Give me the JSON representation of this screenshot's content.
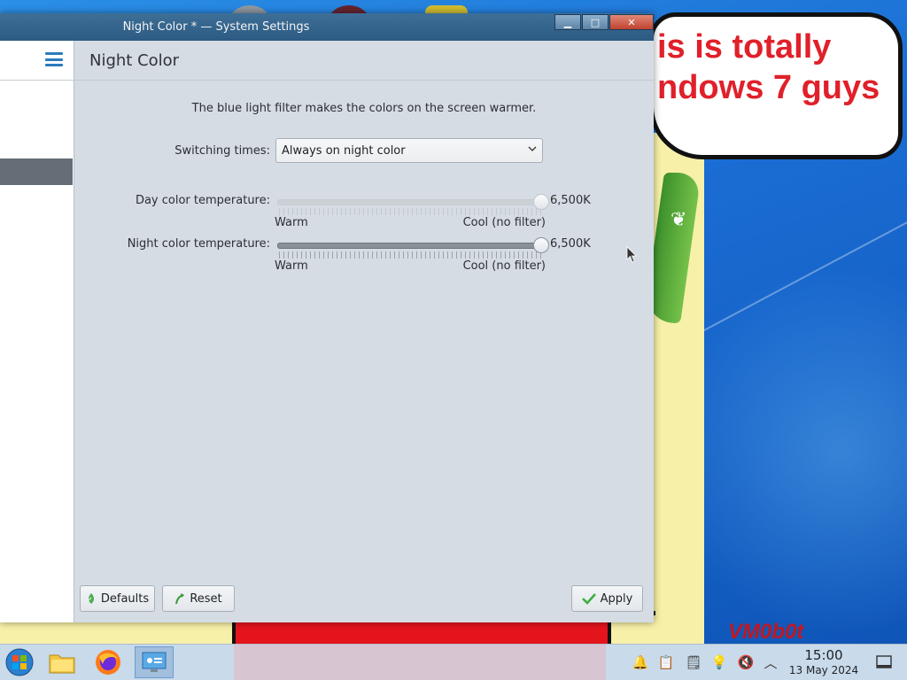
{
  "window": {
    "title": "Night Color * — System Settings",
    "minimize_glyph": "▁",
    "maximize_glyph": "□",
    "close_glyph": "✕"
  },
  "page": {
    "title": "Night Color",
    "description": "The blue light filter makes the colors on the screen warmer."
  },
  "switching": {
    "label": "Switching times:",
    "selected": "Always on night color"
  },
  "day_temp": {
    "label": "Day color temperature:",
    "value_text": "6,500K",
    "warm_label": "Warm",
    "cool_label": "Cool (no filter)",
    "level": 1.0,
    "enabled": false
  },
  "night_temp": {
    "label": "Night color temperature:",
    "value_text": "6,500K",
    "warm_label": "Warm",
    "cool_label": "Cool (no filter)",
    "level": 1.0,
    "enabled": true
  },
  "footer": {
    "defaults_label": "Defaults",
    "reset_label": "Reset",
    "apply_label": "Apply"
  },
  "desktop": {
    "bubble_line1": "is is totally",
    "bubble_line2": "ndows 7 guys",
    "watermark": "VM0b0t"
  },
  "taskbar": {
    "apps": [
      "start-menu-icon",
      "file-manager-icon",
      "firefox-icon",
      "system-settings-icon"
    ],
    "tray": [
      "notifications-icon",
      "clipboard-icon",
      "tasks-icon",
      "night-color-icon",
      "volume-muted-icon",
      "expand-tray-icon"
    ],
    "time": "15:00",
    "date": "13 May 2024"
  },
  "colors": {
    "accent": "#2a7bbf",
    "window_bg": "#d5dce4",
    "titlebar": "#2c5a82"
  }
}
